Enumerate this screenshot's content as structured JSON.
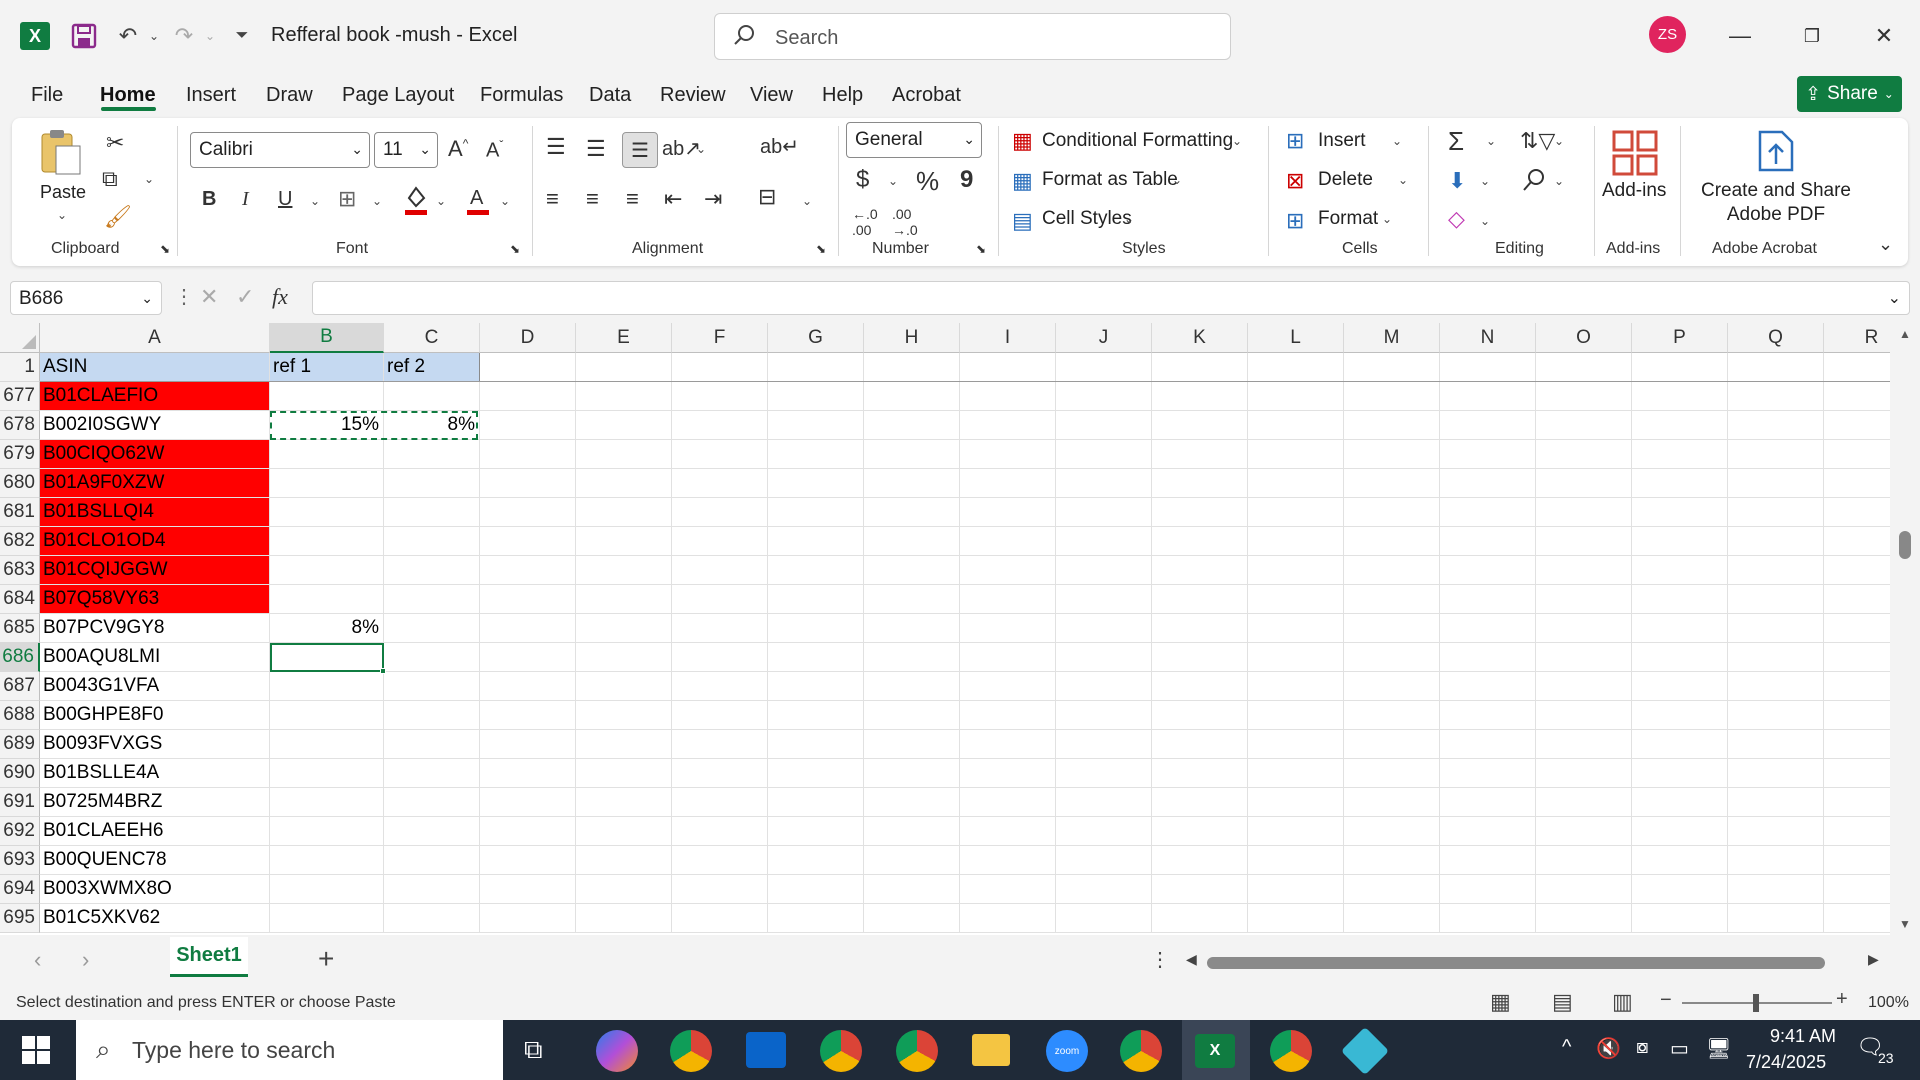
{
  "window": {
    "title": "Refferal book -mush  -  Excel",
    "search_placeholder": "Search",
    "user_initials": "ZS"
  },
  "menu": {
    "tabs": [
      "File",
      "Home",
      "Insert",
      "Draw",
      "Page Layout",
      "Formulas",
      "Data",
      "Review",
      "View",
      "Help",
      "Acrobat"
    ],
    "active": "Home",
    "share": "Share"
  },
  "ribbon": {
    "clipboard": {
      "paste": "Paste",
      "label": "Clipboard"
    },
    "font": {
      "name": "Calibri",
      "size": "11",
      "label": "Font"
    },
    "alignment": {
      "label": "Alignment"
    },
    "number": {
      "format": "General",
      "label": "Number"
    },
    "styles": {
      "conditional": "Conditional Formatting",
      "table": "Format as Table",
      "cell": "Cell Styles",
      "label": "Styles"
    },
    "cells": {
      "insert": "Insert",
      "delete": "Delete",
      "format": "Format",
      "label": "Cells"
    },
    "editing": {
      "label": "Editing"
    },
    "addins": {
      "button": "Add-ins",
      "label": "Add-ins"
    },
    "acrobat": {
      "line1": "Create and Share",
      "line2": "Adobe PDF",
      "label": "Adobe Acrobat"
    }
  },
  "formula_bar": {
    "name_box": "B686",
    "fx": "fx",
    "value": ""
  },
  "grid": {
    "columns": [
      "A",
      "B",
      "C",
      "D",
      "E",
      "F",
      "G",
      "H",
      "I",
      "J",
      "K",
      "L",
      "M",
      "N",
      "O",
      "P",
      "Q",
      "R"
    ],
    "selected_column": "B",
    "header_row": {
      "num": "1",
      "A": "ASIN",
      "B": "ref 1",
      "C": "ref 2"
    },
    "rows": [
      {
        "num": "677",
        "A": "B01CLAEFIO",
        "B": "",
        "C": "",
        "red": true
      },
      {
        "num": "678",
        "A": "B002I0SGWY",
        "B": "15%",
        "C": "8%",
        "red": false
      },
      {
        "num": "679",
        "A": "B00CIQO62W",
        "B": "",
        "C": "",
        "red": true
      },
      {
        "num": "680",
        "A": "B01A9F0XZW",
        "B": "",
        "C": "",
        "red": true
      },
      {
        "num": "681",
        "A": "B01BSLLQI4",
        "B": "",
        "C": "",
        "red": true
      },
      {
        "num": "682",
        "A": "B01CLO1OD4",
        "B": "",
        "C": "",
        "red": true
      },
      {
        "num": "683",
        "A": "B01CQIJGGW",
        "B": "",
        "C": "",
        "red": true
      },
      {
        "num": "684",
        "A": "B07Q58VY63",
        "B": "",
        "C": "",
        "red": true
      },
      {
        "num": "685",
        "A": "B07PCV9GY8",
        "B": "8%",
        "C": "",
        "red": false
      },
      {
        "num": "686",
        "A": "B00AQU8LMI",
        "B": "",
        "C": "",
        "red": false
      },
      {
        "num": "687",
        "A": "B0043G1VFA",
        "B": "",
        "C": "",
        "red": false
      },
      {
        "num": "688",
        "A": "B00GHPE8F0",
        "B": "",
        "C": "",
        "red": false
      },
      {
        "num": "689",
        "A": "B0093FVXGS",
        "B": "",
        "C": "",
        "red": false
      },
      {
        "num": "690",
        "A": "B01BSLLE4A",
        "B": "",
        "C": "",
        "red": false
      },
      {
        "num": "691",
        "A": "B0725M4BRZ",
        "B": "",
        "C": "",
        "red": false
      },
      {
        "num": "692",
        "A": "B01CLAEEH6",
        "B": "",
        "C": "",
        "red": false
      },
      {
        "num": "693",
        "A": "B00QUENC78",
        "B": "",
        "C": "",
        "red": false
      },
      {
        "num": "694",
        "A": "B003XWMX8O",
        "B": "",
        "C": "",
        "red": false
      },
      {
        "num": "695",
        "A": "B01C5XKV62",
        "B": "",
        "C": "",
        "red": false
      }
    ]
  },
  "sheets": {
    "tabs": [
      "Sheet1"
    ],
    "active": "Sheet1"
  },
  "status": {
    "message": "Select destination and press ENTER or choose Paste",
    "zoom": "100%"
  },
  "taskbar": {
    "search_placeholder": "Type here to search",
    "time": "9:41 AM",
    "date": "7/24/2025",
    "notifications": "23"
  },
  "colors": {
    "excel_green": "#107c41",
    "red_fill": "#ff0000",
    "header_fill": "#c5d9f1"
  }
}
